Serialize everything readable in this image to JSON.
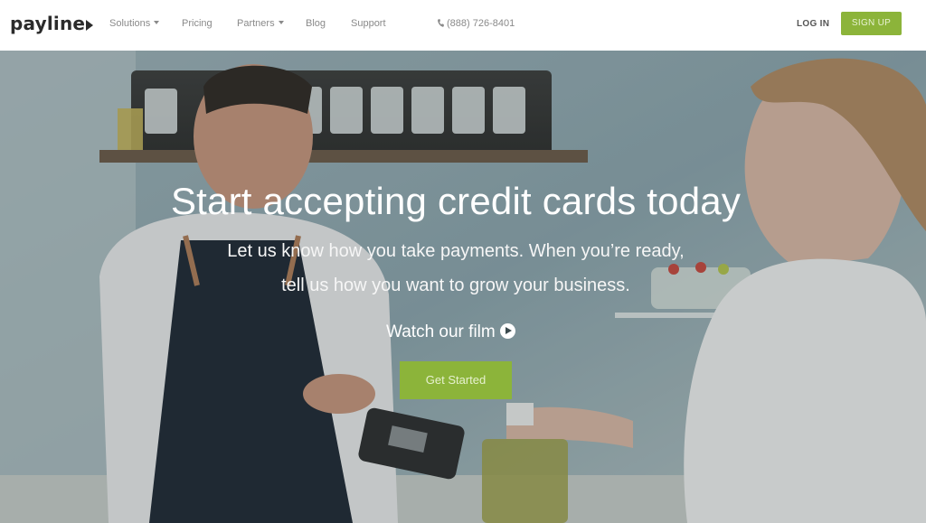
{
  "brand": {
    "logo_text": "payline"
  },
  "nav": {
    "items": [
      {
        "label": "Solutions",
        "has_dropdown": true
      },
      {
        "label": "Pricing",
        "has_dropdown": false
      },
      {
        "label": "Partners",
        "has_dropdown": true
      },
      {
        "label": "Blog",
        "has_dropdown": false
      },
      {
        "label": "Support",
        "has_dropdown": false
      }
    ],
    "phone": "(888) 726-8401",
    "login_label": "LOG IN",
    "signup_label": "SIGN UP"
  },
  "hero": {
    "title": "Start accepting credit cards today",
    "subtitle_line1": "Let us know how you take payments. When you’re ready,",
    "subtitle_line2": "tell us how you want to grow your business.",
    "watch_label": "Watch our film",
    "cta_label": "Get Started"
  },
  "colors": {
    "accent": "#8cb43a",
    "text_dark": "#2b2b2b",
    "nav_text": "#8a8a8a"
  },
  "icons": [
    "phone-icon",
    "play-icon",
    "chevron-down-icon"
  ]
}
